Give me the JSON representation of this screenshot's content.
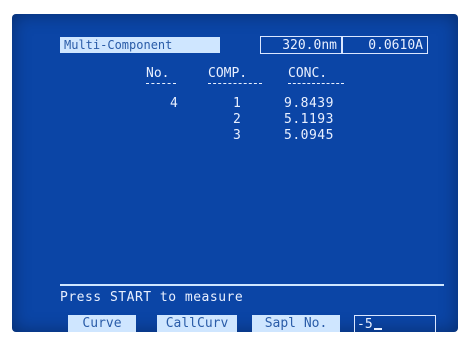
{
  "screen": {
    "mode_label": "Multi-Component",
    "wavelength": "320.0nm",
    "absorbance": "0.0610A"
  },
  "table": {
    "headers": [
      "No.",
      "COMP.",
      "CONC."
    ],
    "sample_no": "4",
    "rows": [
      {
        "comp": "1",
        "conc": "9.8439"
      },
      {
        "comp": "2",
        "conc": "5.1193"
      },
      {
        "comp": "3",
        "conc": "5.0945"
      }
    ]
  },
  "prompt": "Press START to measure",
  "softkeys": {
    "curve": "Curve",
    "callcurv": "CallCurv",
    "sapl_no": "Sapl No."
  },
  "input": {
    "prefix": "-",
    "value": "5"
  },
  "colors": {
    "screen_bg": "#0b45a6",
    "text": "#e9f0ff",
    "highlight_bg": "#cfe6ff",
    "highlight_text": "#2a5ca8"
  }
}
